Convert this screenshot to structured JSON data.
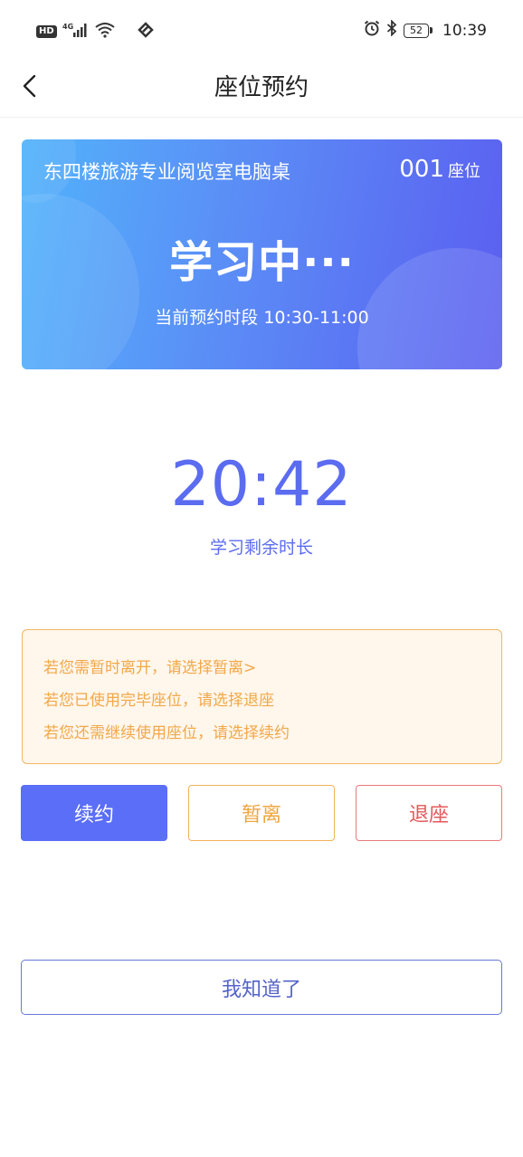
{
  "status_bar": {
    "hd": "HD",
    "network": "4G",
    "battery": "52",
    "time": "10:39",
    "icons": [
      "signal-icon",
      "wifi-icon",
      "app-notification-icon",
      "alarm-icon",
      "bluetooth-icon",
      "battery-icon"
    ]
  },
  "nav": {
    "title": "座位预约",
    "back_icon": "chevron-left-icon"
  },
  "seat_card": {
    "room_name": "东四楼旅游专业阅览室电脑桌",
    "seat_number": "001",
    "seat_unit": "座位",
    "status": "学习中···",
    "period": "当前预约时段 10:30-11:00"
  },
  "countdown": {
    "value": "20:42",
    "label": "学习剩余时长"
  },
  "tips": [
    "若您需暂时离开，请选择暂离>",
    "若您已使用完毕座位，请选择退座",
    "若您还需继续使用座位，请选择续约"
  ],
  "actions": {
    "renew": "续约",
    "leave": "暂离",
    "checkout": "退座"
  },
  "confirm": "我知道了",
  "colors": {
    "primary": "#5b6ef7",
    "warning": "#f0a540",
    "danger": "#e5585a",
    "tip_bg": "#fff6ec"
  }
}
